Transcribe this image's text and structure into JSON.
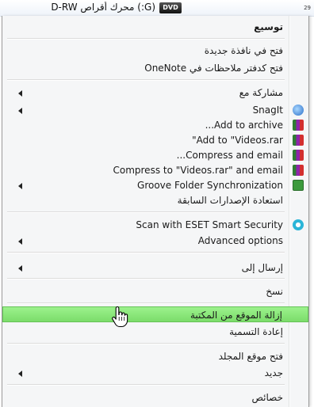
{
  "topbar": {
    "drive_label": "(G:) محرك أقراص D-RW",
    "dvd_badge": "DVD",
    "right_number": "29"
  },
  "menu": {
    "items": [
      {
        "label": "توسيع",
        "bold": true
      },
      {
        "label": "فتح في نافذة جديدة"
      },
      {
        "label": "فتح كدفتر ملاحظات في OneNote"
      },
      {
        "label": "مشاركة مع",
        "submenu": true
      },
      {
        "label": "SnagIt",
        "submenu": true,
        "icon": "snagit-icon"
      },
      {
        "label": "Add to archive...",
        "icon": "winrar-icon"
      },
      {
        "label": "Add to \"Videos.rar\"",
        "icon": "winrar-icon"
      },
      {
        "label": "Compress and email...",
        "icon": "winrar-icon"
      },
      {
        "label": "Compress to \"Videos.rar\" and email",
        "icon": "winrar-icon"
      },
      {
        "label": "Groove Folder Synchronization",
        "submenu": true,
        "icon": "groove-icon"
      },
      {
        "label": "استعادة الإصدارات السابقة"
      },
      {
        "label": "Scan with ESET Smart Security",
        "icon": "eset-icon"
      },
      {
        "label": "Advanced options",
        "submenu": true
      },
      {
        "label": "إرسال إلى",
        "submenu": true
      },
      {
        "label": "نسخ"
      },
      {
        "label": "إزالة الموقع من المكتبة",
        "highlighted": true
      },
      {
        "label": "إعادة التسمية"
      },
      {
        "label": "فتح موقع المجلد"
      },
      {
        "label": "جديد",
        "submenu": true
      },
      {
        "label": "خصائص"
      }
    ]
  },
  "colors": {
    "highlight": "#8ae27a",
    "menu_bg": "#f5f6f7"
  }
}
